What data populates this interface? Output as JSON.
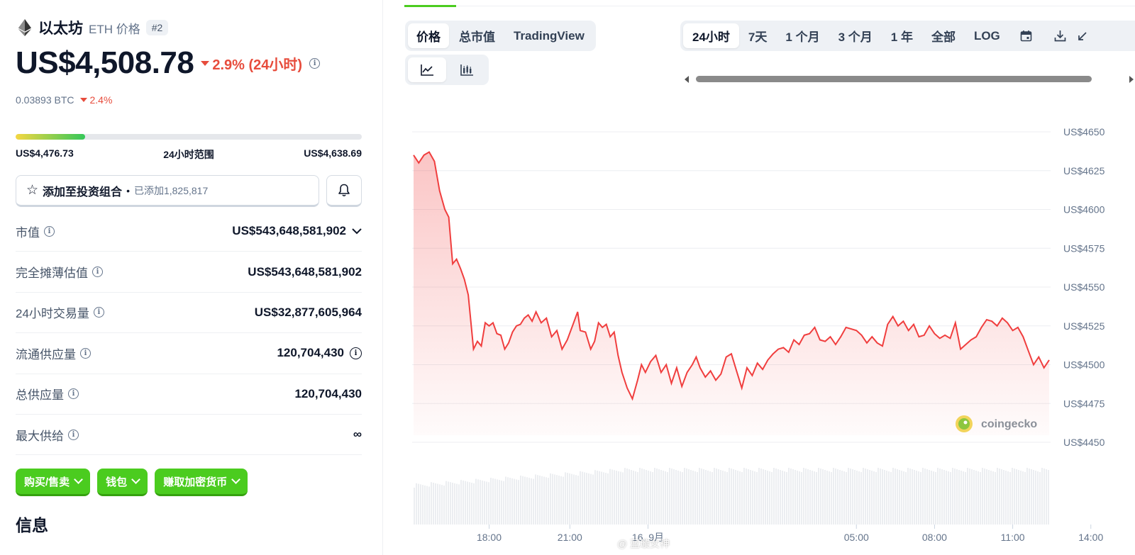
{
  "coin": {
    "name": "以太坊",
    "subtitle": "ETH 价格",
    "rank": "#2",
    "price": "US$4,508.78",
    "change_24h": "2.9% (24小时)",
    "btc_price": "0.03893 BTC",
    "btc_change": "2.4%"
  },
  "range": {
    "low": "US$4,476.73",
    "label": "24小时范围",
    "high": "US$4,638.69",
    "position_fraction": 0.2
  },
  "portfolio": {
    "label": "添加至投资组合",
    "dot": "•",
    "added": "已添加1,825,817"
  },
  "stats": [
    {
      "label": "市值",
      "value": "US$543,648,581,902"
    },
    {
      "label": "完全摊薄估值",
      "value": "US$543,648,581,902"
    },
    {
      "label": "24小时交易量",
      "value": "US$32,877,605,964"
    },
    {
      "label": "流通供应量",
      "value": "120,704,430"
    },
    {
      "label": "总供应量",
      "value": "120,704,430"
    },
    {
      "label": "最大供给",
      "value": "∞"
    }
  ],
  "actions": [
    {
      "label": "购买/售卖"
    },
    {
      "label": "钱包"
    },
    {
      "label": "赚取加密货币"
    }
  ],
  "info_heading": "信息",
  "chart_tabs": [
    {
      "label": "价格",
      "active": true
    },
    {
      "label": "总市值",
      "active": false
    },
    {
      "label": "TradingView",
      "active": false
    }
  ],
  "time_tabs": [
    {
      "label": "24小时",
      "active": true
    },
    {
      "label": "7天",
      "active": false
    },
    {
      "label": "1 个月",
      "active": false
    },
    {
      "label": "3 个月",
      "active": false
    },
    {
      "label": "1 年",
      "active": false
    },
    {
      "label": "全部",
      "active": false
    },
    {
      "label": "LOG",
      "active": false
    }
  ],
  "icons": {
    "line_chart": "line-chart-icon",
    "candle_chart": "candlestick-icon",
    "calendar": "calendar-icon",
    "download": "download-icon",
    "expand": "expand-icon",
    "bell": "bell-icon",
    "star": "star-icon"
  },
  "colors": {
    "accent_green": "#4bcc1f",
    "down_red": "#e74c3c",
    "line_red": "#f03e3e"
  },
  "brand": "coingecko",
  "watermark": "@ 蓝璇女神",
  "chart_data": {
    "type": "area",
    "y_ticks": [
      "US$4650",
      "US$4625",
      "US$4600",
      "US$4575",
      "US$4550",
      "US$4525",
      "US$4500",
      "US$4475",
      "US$4450"
    ],
    "ylim": [
      4450,
      4650
    ],
    "x_ticks": [
      "18:00",
      "21:00",
      "16. 9月",
      "05:00",
      "08:00",
      "11:00",
      "14:00"
    ],
    "x_tick_hours": [
      3.1,
      6.2,
      9.2,
      17.2,
      20.2,
      23.2,
      26.2
    ],
    "xlim_hours": [
      0.2,
      24.6
    ],
    "grid": true,
    "price_points": [
      [
        0.2,
        4635
      ],
      [
        0.4,
        4630
      ],
      [
        0.6,
        4635
      ],
      [
        0.8,
        4637
      ],
      [
        1.0,
        4631
      ],
      [
        1.2,
        4612
      ],
      [
        1.4,
        4600
      ],
      [
        1.55,
        4595
      ],
      [
        1.7,
        4565
      ],
      [
        1.85,
        4568
      ],
      [
        2.0,
        4562
      ],
      [
        2.15,
        4555
      ],
      [
        2.3,
        4545
      ],
      [
        2.5,
        4510
      ],
      [
        2.65,
        4515
      ],
      [
        2.8,
        4512
      ],
      [
        2.95,
        4527
      ],
      [
        3.1,
        4525
      ],
      [
        3.25,
        4527
      ],
      [
        3.4,
        4520
      ],
      [
        3.55,
        4519
      ],
      [
        3.7,
        4510
      ],
      [
        3.85,
        4514
      ],
      [
        4.0,
        4521
      ],
      [
        4.15,
        4525
      ],
      [
        4.3,
        4526
      ],
      [
        4.45,
        4530
      ],
      [
        4.6,
        4532
      ],
      [
        4.75,
        4528
      ],
      [
        4.9,
        4534
      ],
      [
        5.1,
        4527
      ],
      [
        5.3,
        4530
      ],
      [
        5.5,
        4518
      ],
      [
        5.7,
        4522
      ],
      [
        5.9,
        4510
      ],
      [
        6.1,
        4516
      ],
      [
        6.3,
        4525
      ],
      [
        6.5,
        4534
      ],
      [
        6.6,
        4522
      ],
      [
        6.8,
        4521
      ],
      [
        7.0,
        4510
      ],
      [
        7.15,
        4515
      ],
      [
        7.3,
        4527
      ],
      [
        7.45,
        4524
      ],
      [
        7.6,
        4526
      ],
      [
        7.75,
        4518
      ],
      [
        7.9,
        4521
      ],
      [
        8.05,
        4506
      ],
      [
        8.2,
        4495
      ],
      [
        8.4,
        4485
      ],
      [
        8.6,
        4478
      ],
      [
        8.8,
        4490
      ],
      [
        8.95,
        4500
      ],
      [
        9.1,
        4495
      ],
      [
        9.3,
        4502
      ],
      [
        9.5,
        4506
      ],
      [
        9.7,
        4495
      ],
      [
        9.9,
        4500
      ],
      [
        10.1,
        4488
      ],
      [
        10.3,
        4498
      ],
      [
        10.5,
        4486
      ],
      [
        10.7,
        4495
      ],
      [
        10.9,
        4500
      ],
      [
        11.05,
        4505
      ],
      [
        11.2,
        4498
      ],
      [
        11.4,
        4492
      ],
      [
        11.6,
        4496
      ],
      [
        11.8,
        4490
      ],
      [
        12.0,
        4494
      ],
      [
        12.2,
        4505
      ],
      [
        12.4,
        4507
      ],
      [
        12.6,
        4496
      ],
      [
        12.8,
        4485
      ],
      [
        13.0,
        4498
      ],
      [
        13.2,
        4493
      ],
      [
        13.4,
        4501
      ],
      [
        13.6,
        4497
      ],
      [
        13.8,
        4503
      ],
      [
        14.0,
        4507
      ],
      [
        14.2,
        4510
      ],
      [
        14.4,
        4511
      ],
      [
        14.6,
        4508
      ],
      [
        14.8,
        4516
      ],
      [
        15.0,
        4513
      ],
      [
        15.2,
        4519
      ],
      [
        15.4,
        4520
      ],
      [
        15.6,
        4524
      ],
      [
        15.8,
        4516
      ],
      [
        16.0,
        4515
      ],
      [
        16.2,
        4518
      ],
      [
        16.4,
        4513
      ],
      [
        16.6,
        4518
      ],
      [
        16.8,
        4524
      ],
      [
        17.0,
        4523
      ],
      [
        17.2,
        4522
      ],
      [
        17.4,
        4519
      ],
      [
        17.6,
        4514
      ],
      [
        17.8,
        4518
      ],
      [
        18.0,
        4514
      ],
      [
        18.2,
        4512
      ],
      [
        18.4,
        4526
      ],
      [
        18.6,
        4531
      ],
      [
        18.8,
        4525
      ],
      [
        19.0,
        4528
      ],
      [
        19.2,
        4522
      ],
      [
        19.4,
        4526
      ],
      [
        19.6,
        4518
      ],
      [
        19.8,
        4519
      ],
      [
        20.0,
        4525
      ],
      [
        20.2,
        4520
      ],
      [
        20.4,
        4517
      ],
      [
        20.6,
        4519
      ],
      [
        20.8,
        4517
      ],
      [
        21.0,
        4527
      ],
      [
        21.2,
        4510
      ],
      [
        21.4,
        4513
      ],
      [
        21.6,
        4516
      ],
      [
        21.8,
        4518
      ],
      [
        22.0,
        4524
      ],
      [
        22.2,
        4529
      ],
      [
        22.4,
        4528
      ],
      [
        22.6,
        4525
      ],
      [
        22.8,
        4530
      ],
      [
        23.0,
        4527
      ],
      [
        23.2,
        4522
      ],
      [
        23.4,
        4524
      ],
      [
        23.6,
        4518
      ],
      [
        23.8,
        4509
      ],
      [
        24.0,
        4500
      ],
      [
        24.2,
        4505
      ],
      [
        24.4,
        4498
      ],
      [
        24.6,
        4503
      ]
    ]
  }
}
